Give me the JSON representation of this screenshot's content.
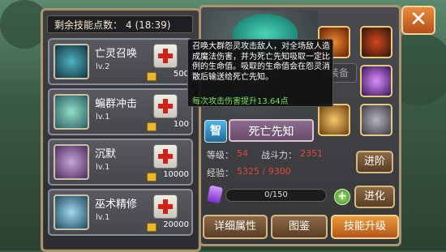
{
  "points_label": "剩余技能点数：",
  "points_value": "4 (18:39)",
  "skills": [
    {
      "name": "亡灵召唤",
      "level": "lv.2",
      "cost": "500"
    },
    {
      "name": "蝙群冲击",
      "level": "lv.1",
      "cost": "100"
    },
    {
      "name": "沉默",
      "level": "lv.1",
      "cost": "10000"
    },
    {
      "name": "巫术精修",
      "level": "lv.1",
      "cost": "20000"
    }
  ],
  "tooltip": {
    "description": "召唤大群怨灵攻击敌人，对全场敌人造成魔法伤害，并为死亡先知吸取一定比例的生命值。吸取的生命值会在怨灵消散后输送给死亡先知。",
    "bonus": "每次攻击伤害提升13.64点"
  },
  "hero": {
    "unequipped": "未装备",
    "class_badge": "智",
    "name": "死亡先知",
    "level_label": "等级：",
    "level_value": "54",
    "power_label": "战斗力：",
    "power_value": "2351",
    "exp_label": "经验：",
    "exp_value": "5325 / 9300",
    "progress_text": "0/150",
    "progress_fraction": 0
  },
  "buttons": {
    "advance": "进阶",
    "evolve": "进化",
    "details": "详细属性",
    "codex": "图鉴",
    "skill_upgrade": "技能升级",
    "close": "✕"
  },
  "colors": {
    "frame": "#a99572",
    "accent_red": "#e4463a",
    "bonus_green": "#7ae05f"
  }
}
